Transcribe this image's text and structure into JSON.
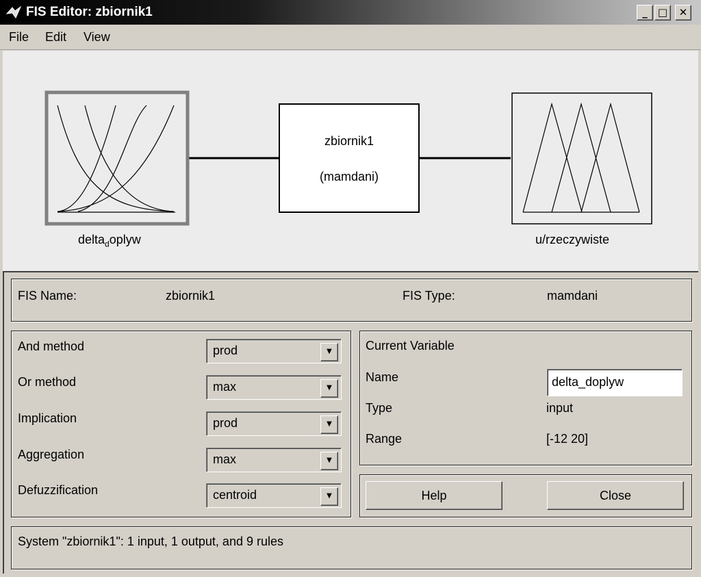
{
  "window": {
    "title": "FIS Editor: zbiornik1",
    "minimize": "_",
    "maximize": "□",
    "close": "✕"
  },
  "menu": [
    "File",
    "Edit",
    "View"
  ],
  "diagram": {
    "input_label_a": "delta",
    "input_label_sub": "d",
    "input_label_b": "oplyw",
    "system_name": "zbiornik1",
    "system_type": "(mamdani)",
    "output_label": "u/rzeczywiste"
  },
  "fis": {
    "name_label": "FIS Name:",
    "name": "zbiornik1",
    "type_label": "FIS Type:",
    "type": "mamdani"
  },
  "methods": [
    {
      "label": "And method",
      "value": "prod"
    },
    {
      "label": "Or method",
      "value": "max"
    },
    {
      "label": "Implication",
      "value": "prod"
    },
    {
      "label": "Aggregation",
      "value": "max"
    },
    {
      "label": "Defuzzification",
      "value": "centroid"
    }
  ],
  "current_variable": {
    "heading": "Current Variable",
    "name_label": "Name",
    "name": "delta_doplyw",
    "type_label": "Type",
    "type": "input",
    "range_label": "Range",
    "range": "[-12 20]"
  },
  "buttons": {
    "help": "Help",
    "close": "Close"
  },
  "status": "System \"zbiornik1\": 1 input, 1 output, and 9 rules"
}
